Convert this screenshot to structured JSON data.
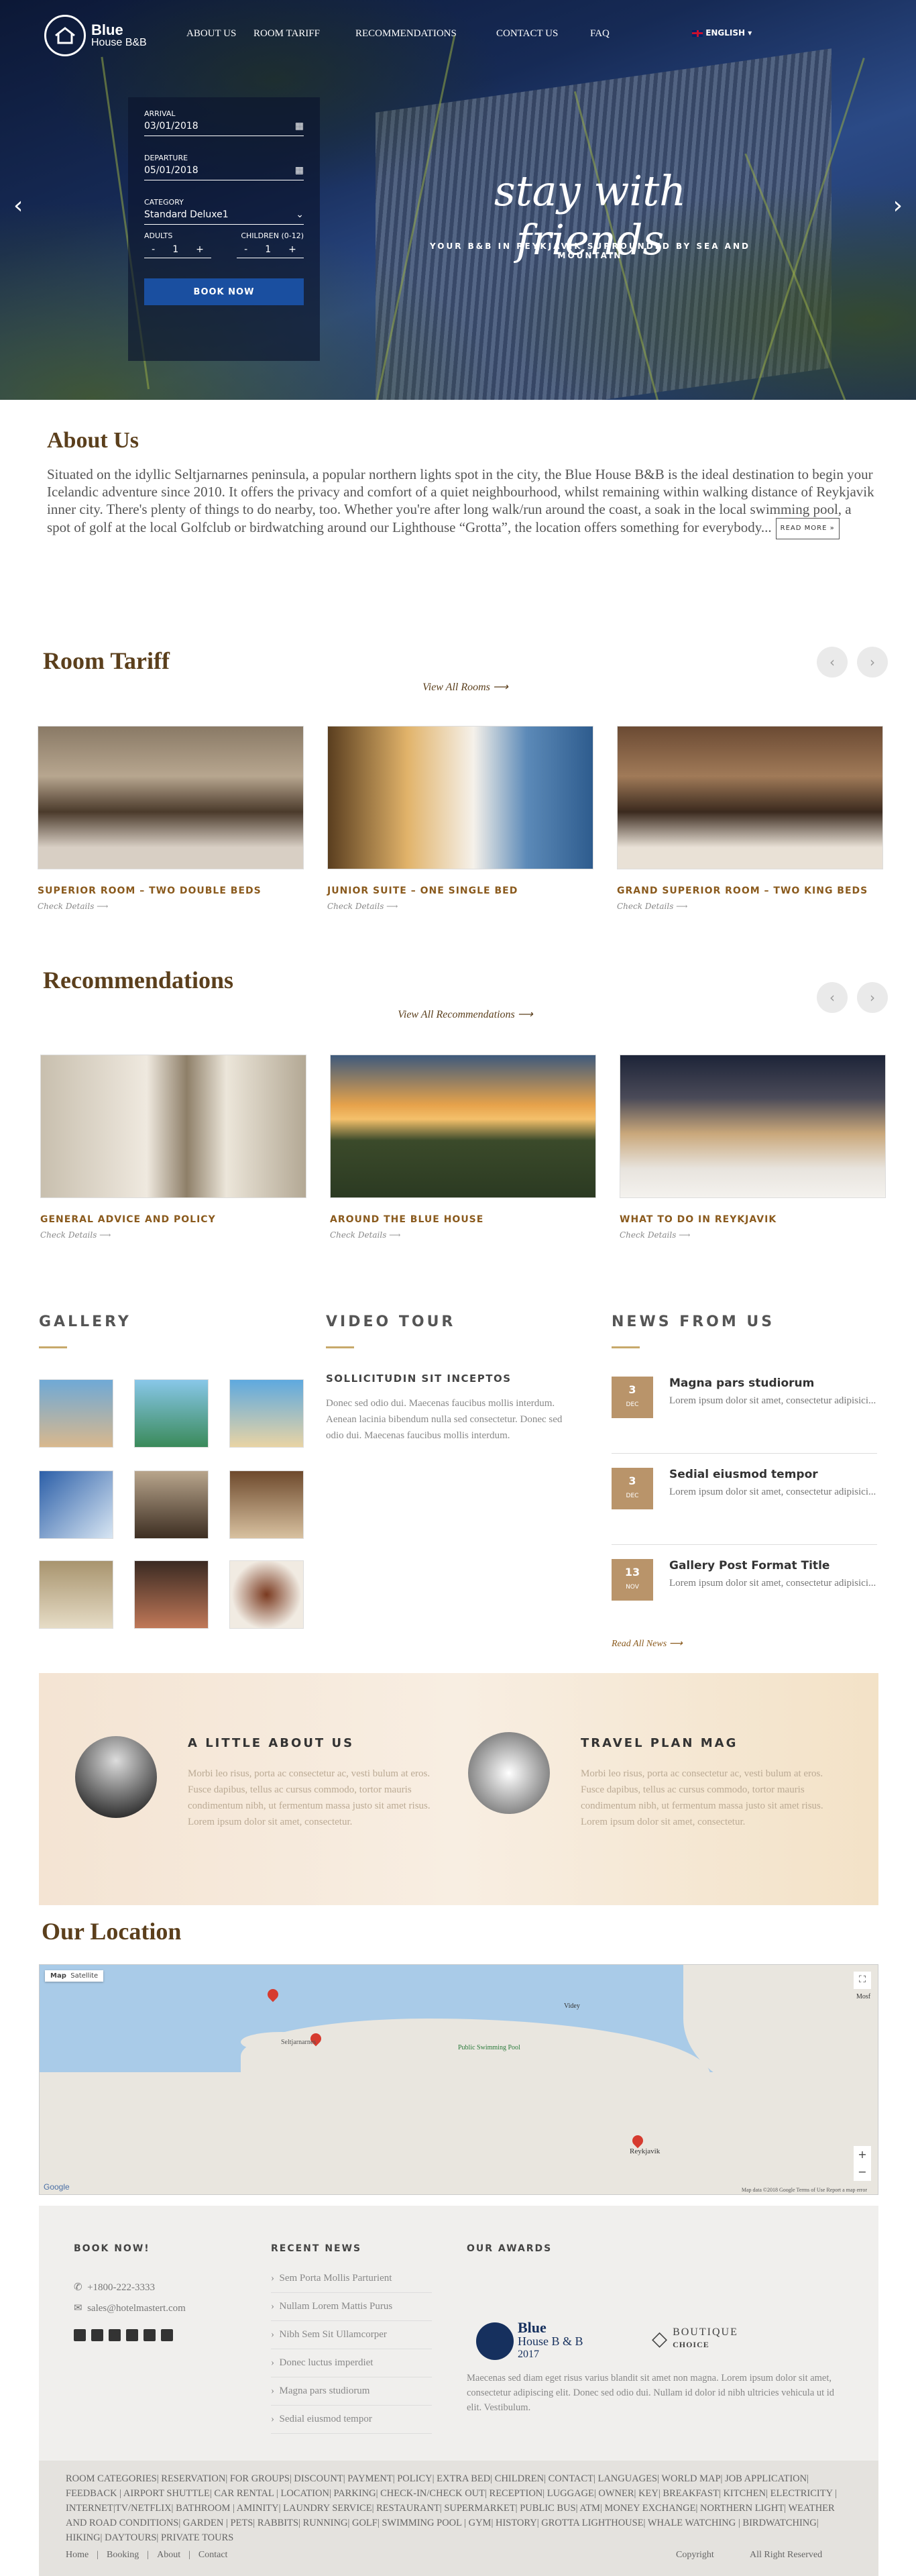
{
  "nav": {
    "brand_line1": "Blue",
    "brand_line2": "House B&B",
    "items": [
      "ABOUT US",
      "ROOM TARIFF",
      "RECOMMENDATIONS",
      "CONTACT US",
      "FAQ"
    ],
    "language": "ENGLISH"
  },
  "booking": {
    "arrival_label": "ARRIVAL",
    "arrival_value": "03/01/2018",
    "departure_label": "DEPARTURE",
    "departure_value": "05/01/2018",
    "category_label": "CATEGORY",
    "category_value": "Standard Deluxe1",
    "adults_label": "ADULTS",
    "adults_value": "1",
    "children_label": "CHILDREN (0-12)",
    "children_value": "1",
    "minus": "-",
    "plus": "+",
    "book_label": "BOOK NOW"
  },
  "hero": {
    "title": "stay with friends",
    "subtitle": "YOUR B&B IN REYKJAVIK SURROUNDED BY SEA AND MOUNTAIN",
    "prev": "‹",
    "next": "›"
  },
  "about": {
    "title": "About Us",
    "text": "Situated on the idyllic Seltjarnarnes peninsula, a popular northern lights spot in the city, the Blue House B&B is the ideal destination to begin your Icelandic adventure since 2010. It offers the privacy and comfort of a quiet neighbourhood, whilst remaining within walking distance of Reykjavik inner city. There's plenty of things to do nearby, too. Whether you're after long walk/run around the coast, a soak in the local swimming pool, a spot of golf at the local Golfclub or birdwatching around our Lighthouse “Grotta”, the location offers something for everybody...",
    "read_more": "READ MORE »"
  },
  "rooms": {
    "title": "Room Tariff",
    "view_all": "View All Rooms",
    "cards": [
      {
        "title": "SUPERIOR ROOM – TWO DOUBLE BEDS",
        "details": "Check Details"
      },
      {
        "title": "JUNIOR SUITE – ONE SINGLE BED",
        "details": "Check Details"
      },
      {
        "title": "GRAND SUPERIOR ROOM – TWO KING BEDS",
        "details": "Check Details"
      }
    ]
  },
  "recs": {
    "title": "Recommendations",
    "view_all": "View All Recommendations",
    "cards": [
      {
        "title": "GENERAL ADVICE AND POLICY",
        "details": "Check Details"
      },
      {
        "title": "AROUND THE BLUE HOUSE",
        "details": "Check Details"
      },
      {
        "title": "WHAT TO DO IN REYKJAVIK",
        "details": "Check Details"
      }
    ]
  },
  "gallery": {
    "title": "GALLERY"
  },
  "video": {
    "title": "VIDEO TOUR",
    "subtitle": "SOLLICITUDIN SIT INCEPTOS",
    "text": "Donec sed odio dui. Maecenas faucibus mollis interdum. Aenean lacinia bibendum nulla sed consectetur. Donec sed odio dui. Maecenas faucibus mollis interdum."
  },
  "news": {
    "title": "NEWS FROM US",
    "items": [
      {
        "day": "3",
        "month": "DEC",
        "title": "Magna pars studiorum",
        "text": "Lorem ipsum dolor sit amet, consectetur adipisici..."
      },
      {
        "day": "3",
        "month": "DEC",
        "title": "Sedial eiusmod tempor",
        "text": "Lorem ipsum dolor sit amet, consectetur adipisici..."
      },
      {
        "day": "13",
        "month": "NOV",
        "title": "Gallery Post Format Title",
        "text": "Lorem ipsum dolor sit amet, consectetur adipisici..."
      }
    ],
    "read_all": "Read All News"
  },
  "feature": {
    "left_title": "A LITTLE ABOUT US",
    "left_text": "Morbi leo risus, porta ac consectetur ac, vesti bulum at eros. Fusce dapibus, tellus ac cursus commodo, tortor mauris condimentum nibh, ut fermentum massa justo sit amet risus. Lorem ipsum dolor sit amet, consectetur.",
    "right_title": "TRAVEL PLAN MAG",
    "right_text": "Morbi leo risus, porta ac consectetur ac, vesti bulum at eros. Fusce dapibus, tellus ac cursus commodo, tortor mauris condimentum nibh, ut fermentum massa justo sit amet risus. Lorem ipsum dolor sit amet, consectetur."
  },
  "location": {
    "title": "Our Location",
    "map_tab": "Map",
    "satellite_tab": "Satellite",
    "labels": [
      "Seltjarnarnes",
      "Public Swimming Pool",
      "Reykjavik",
      "Videy",
      "Mosf"
    ],
    "footer_note": "Map data ©2018 Google  Terms of Use  Report a map error",
    "google": "Google"
  },
  "footer": {
    "book_title": "BOOK NOW!",
    "phone": "+1800-222-3333",
    "email": "sales@hotelmastert.com",
    "recent_title": "RECENT NEWS",
    "recent": [
      "Sem Porta Mollis Parturient",
      "Nullam Lorem Mattis Purus",
      "Nibh Sem Sit Ullamcorper",
      "Donec luctus imperdiet",
      "Magna pars studiorum",
      "Sedial eiusmod tempor"
    ],
    "awards_title": "OUR AWARDS",
    "award1_line1": "Blue",
    "award1_line2": "House B & B",
    "award1_year": "2017",
    "award2_line1": "BOUTIQUE",
    "award2_line2": "CHOICE",
    "awards_text": "Maecenas sed diam eget risus varius blandit sit amet non magna. Lorem ipsum dolor sit amet, consectetur adipiscing elit. Donec sed odio dui. Nullam id dolor id nibh ultricies vehicula ut id elit. Vestibulum.",
    "tags": "ROOM CATEGORIES| RESERVATION| FOR GROUPS| DISCOUNT| PAYMENT| POLICY| EXTRA BED| CHILDREN| CONTACT| LANGUAGES| WORLD MAP| JOB APPLICATION| FEEDBACK | AIRPORT SHUTTLE| CAR RENTAL | LOCATION| PARKING| CHECK-IN/CHECK OUT| RECEPTION| LUGGAGE| OWNER| KEY| BREAKFAST| KITCHEN| ELECTRICITY | INTERNET|TV/NETFLIX| BATHROOM | AMINITY| LAUNDRY SERVICE| RESTAURANT| SUPERMARKET| PUBLIC BUS| ATM| MONEY EXCHANGE| NORTHERN LIGHT| WEATHER AND ROAD CONDITIONS| GARDEN | PETS| RABBITS| RUNNING| GOLF| SWIMMING POOL | GYM| HISTORY| GROTTA LIGHTHOUSE| WHALE WATCHING | BIRDWATCHING| HIKING| DAYTOURS| PRIVATE TOURS",
    "links": [
      "Home",
      "Booking",
      "About",
      "Contact"
    ],
    "copyright": "Copyright",
    "rights": "All Right Reserved"
  }
}
